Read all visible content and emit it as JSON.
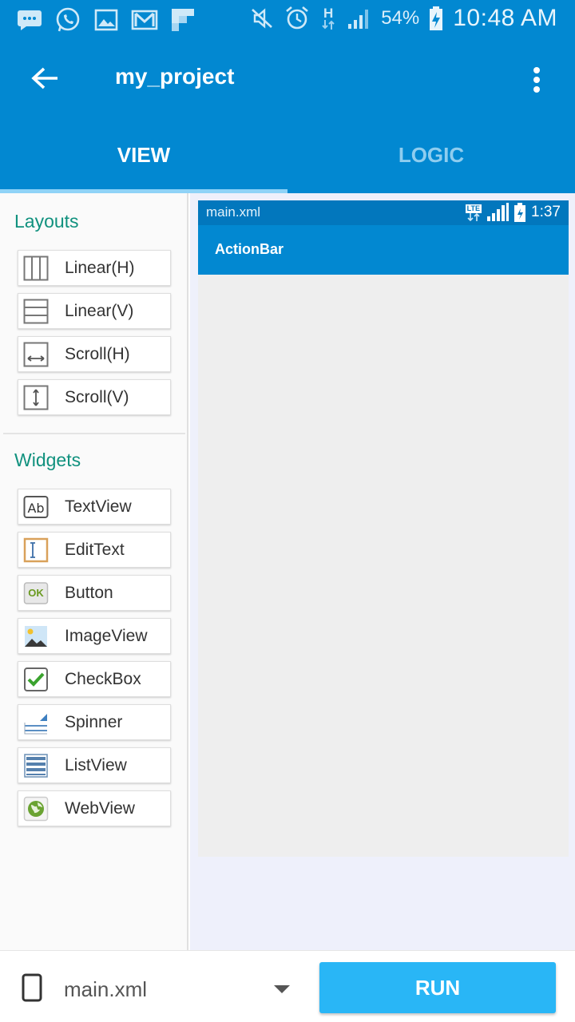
{
  "status_bar": {
    "notification_icons": [
      "messaging-icon",
      "whatsapp-icon",
      "gallery-icon",
      "gmail-icon",
      "flipboard-icon"
    ],
    "system_icons": [
      "mute-icon",
      "alarm-icon",
      "network-h-icon",
      "signal-icon"
    ],
    "network_type": "H",
    "battery_percent": "54%",
    "time": "10:48 AM"
  },
  "app_bar": {
    "title": "my_project",
    "back_icon": "back-arrow-icon",
    "overflow_icon": "more-vert-icon"
  },
  "tabs": [
    {
      "label": "VIEW",
      "active": true
    },
    {
      "label": "LOGIC",
      "active": false
    }
  ],
  "palette": {
    "layouts_title": "Layouts",
    "layouts": [
      {
        "label": "Linear(H)",
        "icon": "linear-horizontal-icon"
      },
      {
        "label": "Linear(V)",
        "icon": "linear-vertical-icon"
      },
      {
        "label": "Scroll(H)",
        "icon": "scroll-horizontal-icon"
      },
      {
        "label": "Scroll(V)",
        "icon": "scroll-vertical-icon"
      }
    ],
    "widgets_title": "Widgets",
    "widgets": [
      {
        "label": "TextView",
        "icon": "textview-icon"
      },
      {
        "label": "EditText",
        "icon": "edittext-icon"
      },
      {
        "label": "Button",
        "icon": "button-icon",
        "icon_text": "OK"
      },
      {
        "label": "ImageView",
        "icon": "imageview-icon"
      },
      {
        "label": "CheckBox",
        "icon": "checkbox-icon"
      },
      {
        "label": "Spinner",
        "icon": "spinner-icon"
      },
      {
        "label": "ListView",
        "icon": "listview-icon"
      },
      {
        "label": "WebView",
        "icon": "webview-icon"
      }
    ]
  },
  "preview": {
    "file_name": "main.xml",
    "status_network": "LTE",
    "time": "1:37",
    "action_bar_title": "ActionBar"
  },
  "bottom_bar": {
    "file_label": "main.xml",
    "run_label": "RUN"
  },
  "colors": {
    "primary": "#0288d1",
    "primary_dark": "#0277bd",
    "accent": "#29b6f6",
    "section_title": "#10917e"
  }
}
